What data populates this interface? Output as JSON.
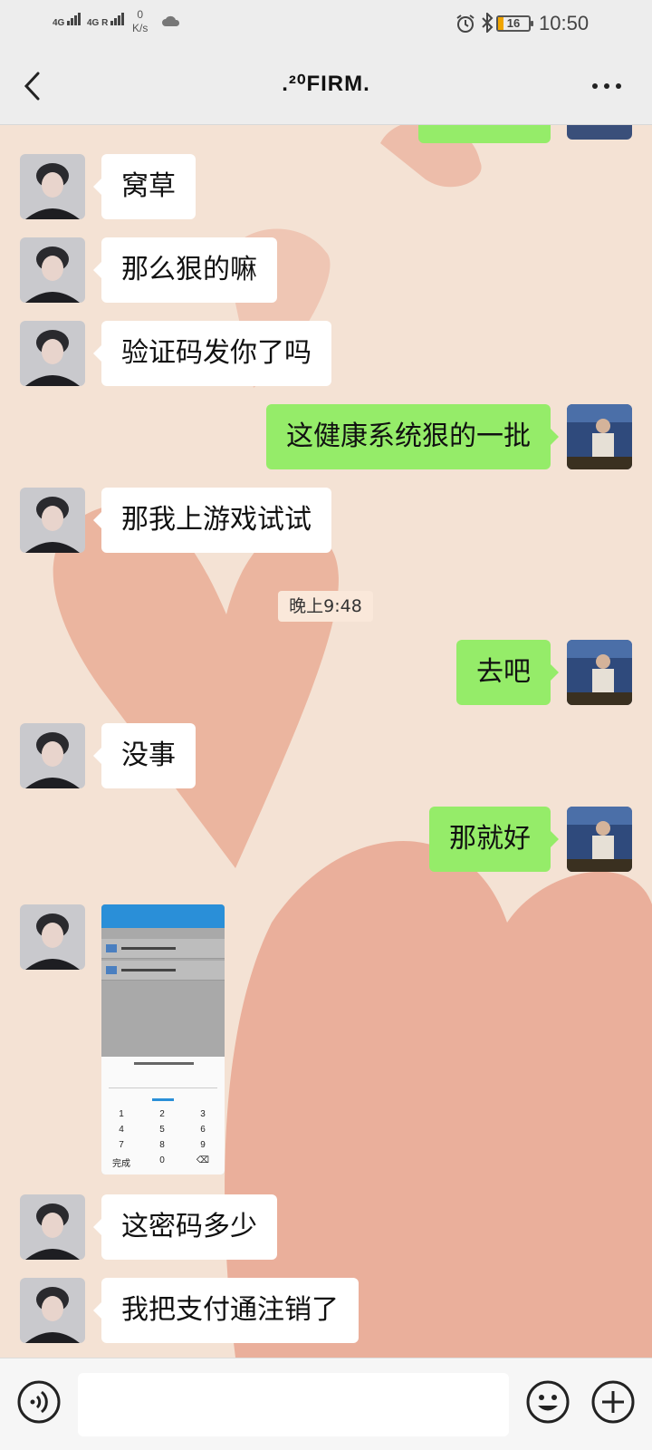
{
  "status_bar": {
    "network_1": "4G",
    "network_2": "4G R",
    "speed_value": "0",
    "speed_unit": "K/s",
    "battery": "16",
    "time": "10:50"
  },
  "header": {
    "title": ".²⁰FIRM."
  },
  "chat": {
    "messages": [
      {
        "side": "in",
        "text": "窝草"
      },
      {
        "side": "in",
        "text": "那么狠的嘛"
      },
      {
        "side": "in",
        "text": "验证码发你了吗"
      },
      {
        "side": "out",
        "text": "这健康系统狠的一批"
      },
      {
        "side": "in",
        "text": "那我上游戏试试"
      },
      {
        "side": "out",
        "text": "去吧"
      },
      {
        "side": "in",
        "text": "没事"
      },
      {
        "side": "out",
        "text": "那就好"
      },
      {
        "side": "in",
        "text": "这密码多少"
      },
      {
        "side": "in",
        "text": "我把支付通注销了"
      }
    ],
    "timestamp": "晚上9:48",
    "shared_image": {
      "keypad_keys": [
        "1",
        "2",
        "3",
        "4",
        "5",
        "6",
        "7",
        "8",
        "9",
        "完成",
        "0",
        "⌫"
      ]
    }
  },
  "composer": {
    "input_value": "",
    "icons": [
      "voice-icon",
      "emoji-icon",
      "plus-icon"
    ]
  },
  "colors": {
    "outgoing_bubble": "#95ec69",
    "incoming_bubble": "#ffffff",
    "bar_background": "#ededed"
  }
}
